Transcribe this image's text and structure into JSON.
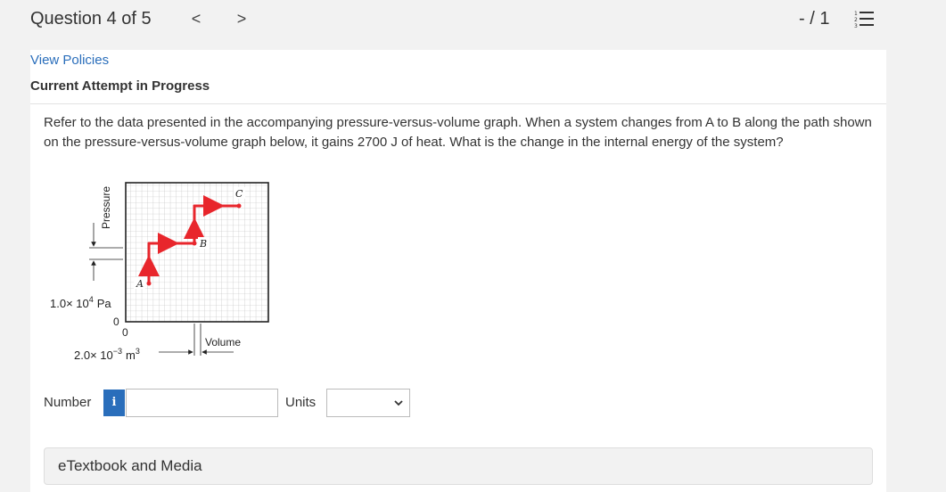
{
  "header": {
    "question_title": "Question 4 of 5",
    "prev_glyph": "<",
    "next_glyph": ">",
    "score": "- / 1"
  },
  "links": {
    "view_policies": "View Policies"
  },
  "attempt_label": "Current Attempt in Progress",
  "question_text": "Refer to the data presented in the accompanying pressure-versus-volume graph. When a system changes from A to B along the path shown on the pressure-versus-volume graph below, it gains 2700 J of heat. What is the change in the internal energy of the system?",
  "figure": {
    "y_axis_label": "Pressure",
    "x_axis_label": "Volume",
    "pressure_scale": "1.0× 10",
    "pressure_exp": "4",
    "pressure_unit": "Pa",
    "volume_scale": "2.0× 10",
    "volume_exp": "−3",
    "volume_unit": "m",
    "volume_unit_exp": "3",
    "origin_y": "0",
    "origin_x": "0",
    "point_a": "A",
    "point_b": "B",
    "point_c": "C",
    "path_color": "#e8262c"
  },
  "answer": {
    "number_label": "Number",
    "info_glyph": "i",
    "number_value": "",
    "units_label": "Units",
    "units_selected": ""
  },
  "etextbook_label": "eTextbook and Media",
  "colors": {
    "link": "#2a6ebb",
    "info_button": "#2a6ebb",
    "background": "#f2f2f2"
  }
}
